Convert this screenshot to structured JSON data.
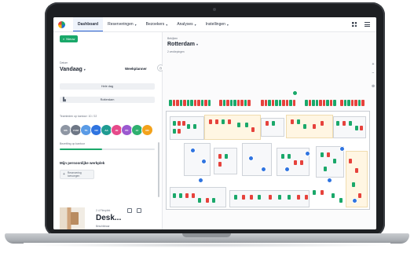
{
  "app": {
    "nav": [
      {
        "label": "Dashboard",
        "active": true
      },
      {
        "label": "Reserveringen",
        "active": false
      },
      {
        "label": "Bezoekers",
        "active": false
      },
      {
        "label": "Analyses",
        "active": false
      },
      {
        "label": "Instellingen",
        "active": false
      }
    ]
  },
  "left": {
    "new_button": "Nieuw",
    "date_label": "Datum",
    "date_value": "Vandaag",
    "weekplanner": "Weekplanner",
    "day_row": "Hele dag",
    "location_row": "Rotterdam",
    "team_label": "Teamleden op kantoor: 10 / 22",
    "avatars": [
      {
        "initials": "MS",
        "color": "#8e96a3"
      },
      {
        "initials": "CVM",
        "color": "#6e7786"
      },
      {
        "initials": "TS",
        "color": "#5a9be6"
      },
      {
        "initials": "CR",
        "color": "#2f74e0"
      },
      {
        "initials": "AA",
        "color": "#1f9c92"
      },
      {
        "initials": "JB",
        "color": "#e64a8a"
      },
      {
        "initials": "PK",
        "color": "#9b59d0"
      },
      {
        "initials": "LV",
        "color": "#2fb06f"
      },
      {
        "initials": "RD",
        "color": "#f3a21b"
      }
    ],
    "occupancy_label": "Bezetting op kantoor",
    "occupancy_fraction": 0.45,
    "section_title": "Mijn persoonlijke werkplek",
    "chip_text": "Reservering toevoegen",
    "card": {
      "meta": "2.4 Flexplek",
      "title": "Desk...",
      "subtitle": "Beschikbaar"
    }
  },
  "map": {
    "location_label": "Bekijken",
    "location_value": "Rotterdam",
    "floor_label": "2 verdiepingen",
    "colors": {
      "available": "#1aa86a",
      "occupied": "#e6423c",
      "selected": "#2f74e0",
      "area": "#fff6e3"
    }
  }
}
